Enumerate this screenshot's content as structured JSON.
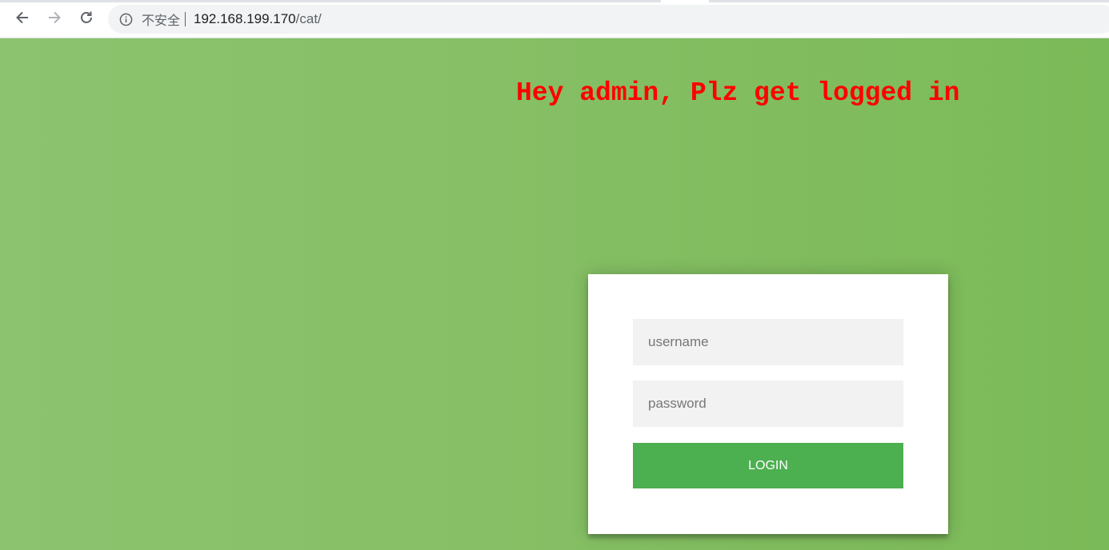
{
  "browser": {
    "security_label": "不安全",
    "url_host": "192.168.199.170",
    "url_path": "/cat/"
  },
  "page": {
    "heading": "Hey admin, Plz get logged in"
  },
  "login_form": {
    "username_placeholder": "username",
    "password_placeholder": "password",
    "login_label": "LOGIN"
  },
  "colors": {
    "background": "#86bf65",
    "heading": "#ff0000",
    "button": "#4caf50"
  }
}
